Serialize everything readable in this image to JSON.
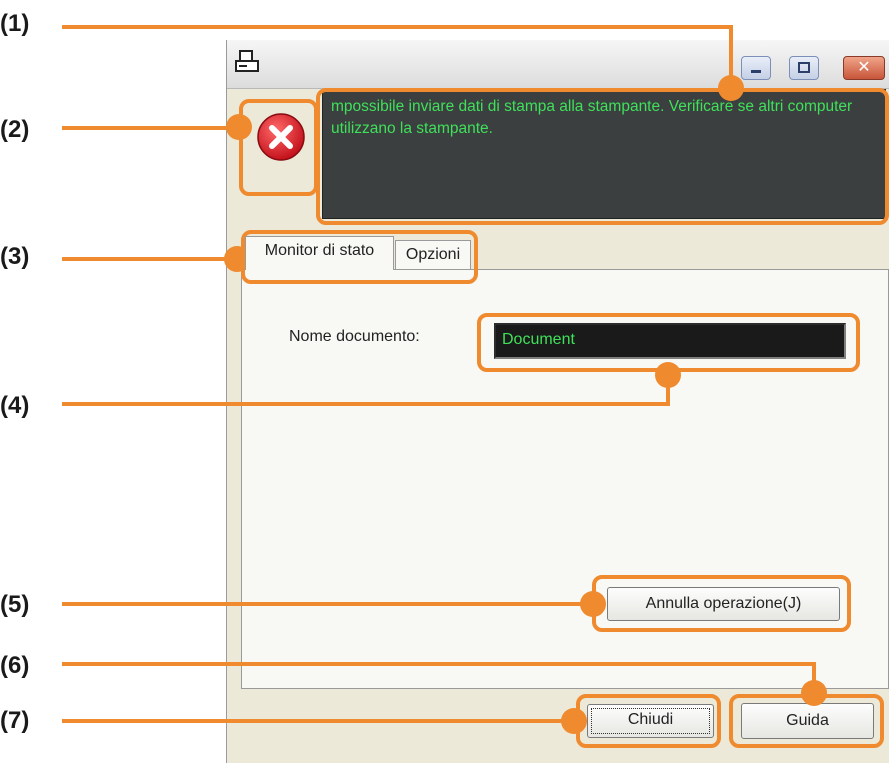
{
  "callouts": [
    "(1)",
    "(2)",
    "(3)",
    "(4)",
    "(5)",
    "(6)",
    "(7)"
  ],
  "window": {
    "title_icon": "printer-icon",
    "controls": [
      "minimize-icon",
      "maximize-icon",
      "close-icon"
    ],
    "close_glyph": "✕"
  },
  "status": {
    "icon": "error-icon",
    "message": "mpossibile inviare dati di stampa alla stampante. Verificare se altri computer utilizzano la stampante."
  },
  "tabs": [
    {
      "label": "Monitor di stato",
      "selected": true
    },
    {
      "label": "Opzioni",
      "selected": false
    }
  ],
  "document": {
    "label": "Nome documento:",
    "value": "Document"
  },
  "buttons": {
    "cancel": "Annulla operazione(J)",
    "close": "Chiudi",
    "help": "Guida"
  },
  "colors": {
    "annotation": "#ef8a2e",
    "status_text": "#3fe05a",
    "error_red": "#e0202a"
  }
}
